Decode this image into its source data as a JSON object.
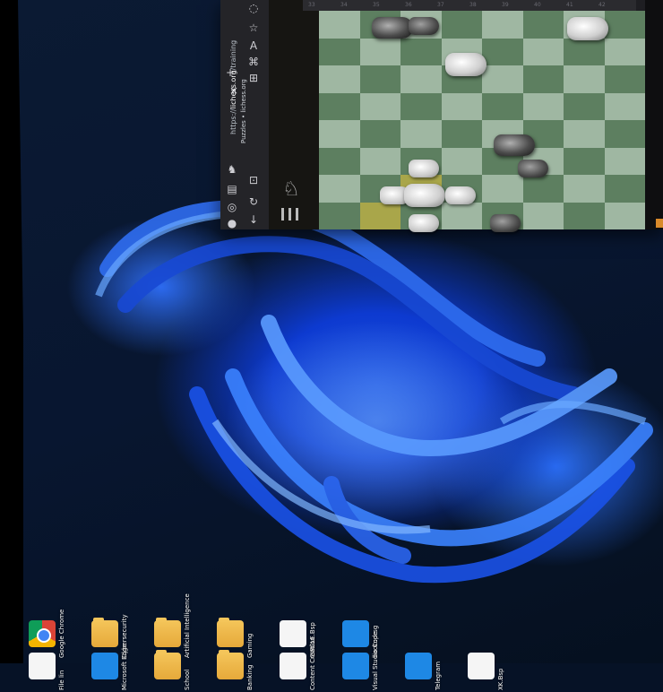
{
  "browser": {
    "tab_title": "Puzzles • lichess.org",
    "url_prefix": "https://",
    "url_host": "lichess.org",
    "url_path": "/training",
    "new_tab_label": "+",
    "close_tab_label": "×"
  },
  "ruler": {
    "ticks": [
      "33",
      "34",
      "35",
      "36",
      "37",
      "38",
      "39",
      "40",
      "41",
      "42"
    ]
  },
  "desktop_icons": [
    {
      "name": "chrome",
      "label": "Google Chrome",
      "kind": "chrome"
    },
    {
      "name": "cybersecurity",
      "label": "Cybersecurity",
      "kind": "folder"
    },
    {
      "name": "ai",
      "label": "Artificial Intelligence",
      "kind": "folder"
    },
    {
      "name": "gaming",
      "label": "Gaming",
      "kind": "folder"
    },
    {
      "name": "circle",
      "label": "CIRCLE.Bsp",
      "kind": "file"
    },
    {
      "name": "backup",
      "label": "backuprsg",
      "kind": "app"
    }
  ],
  "desktop_icons_row2": [
    {
      "name": "file-lin",
      "label": "File lin",
      "kind": "file"
    },
    {
      "name": "edge",
      "label": "Microsoft Edge",
      "kind": "app"
    },
    {
      "name": "school",
      "label": "School",
      "kind": "folder"
    },
    {
      "name": "banking",
      "label": "Banking",
      "kind": "folder"
    },
    {
      "name": "content",
      "label": "Content Creation",
      "kind": "file"
    },
    {
      "name": "vs",
      "label": "Visual Studio Code",
      "kind": "app"
    },
    {
      "name": "telegram",
      "label": "Telegram",
      "kind": "app"
    },
    {
      "name": "xk",
      "label": "XK.Bsp",
      "kind": "file"
    }
  ],
  "colors": {
    "board_light": "#9fb7a2",
    "board_dark": "#5d7f60",
    "highlight": "#a9a64a",
    "desktop_bg": "#0b1a33",
    "bloom": "#1b4fe0"
  }
}
